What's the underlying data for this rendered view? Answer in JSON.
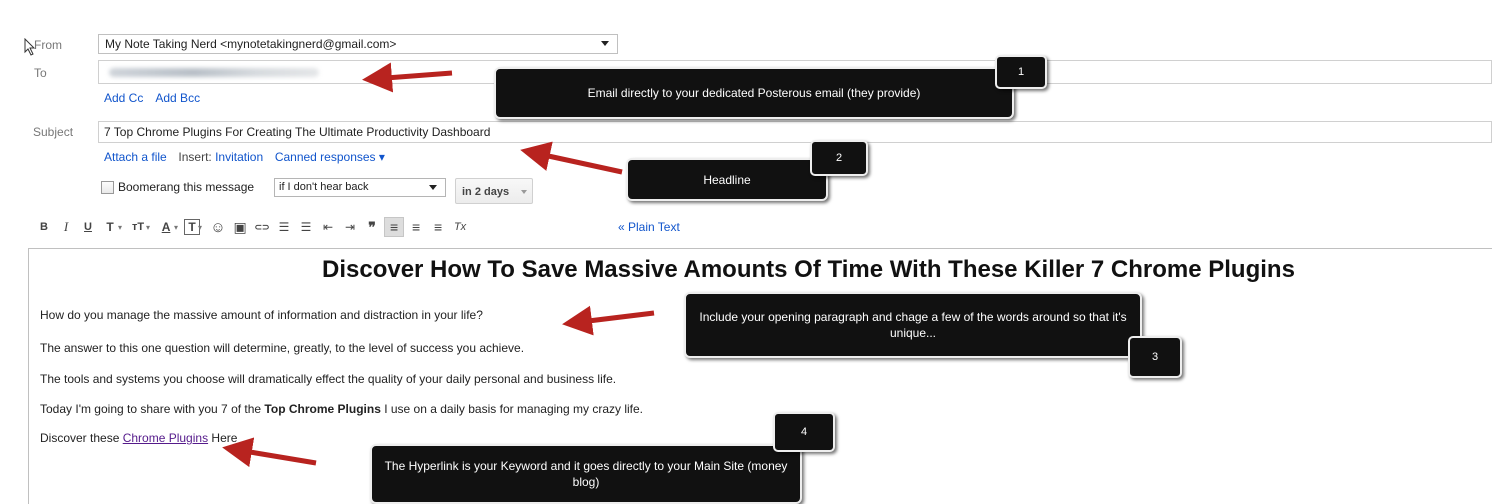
{
  "compose": {
    "from_label": "From",
    "from_value": "My Note Taking Nerd <mynotetakingnerd@gmail.com>",
    "to_label": "To",
    "add_cc": "Add Cc",
    "add_bcc": "Add Bcc",
    "subject_label": "Subject",
    "subject_value": "7 Top Chrome Plugins For Creating The Ultimate Productivity Dashboard",
    "attach_file": "Attach a file",
    "insert_label": "Insert:",
    "invitation": "Invitation",
    "canned_responses": "Canned responses ▾"
  },
  "boomerang": {
    "label": "Boomerang this message",
    "condition": "if I don't hear back",
    "days": "in 2 days"
  },
  "toolbar": {
    "buttons": [
      {
        "icon": "bold-icon",
        "glyph": "B"
      },
      {
        "icon": "italic-icon",
        "glyph": "I"
      },
      {
        "icon": "underline-icon",
        "glyph": "U"
      },
      {
        "icon": "font-icon",
        "glyph": "T"
      },
      {
        "icon": "font-size-icon",
        "glyph": "тT"
      },
      {
        "icon": "text-color-icon",
        "glyph": "A"
      },
      {
        "icon": "highlight-icon",
        "glyph": "T"
      },
      {
        "icon": "emoticon-icon",
        "glyph": "☺"
      },
      {
        "icon": "image-icon",
        "glyph": "▣"
      },
      {
        "icon": "link-icon",
        "glyph": "⊂⊃"
      },
      {
        "icon": "numbered-list-icon",
        "glyph": "☰"
      },
      {
        "icon": "bulleted-list-icon",
        "glyph": "☰"
      },
      {
        "icon": "indent-less-icon",
        "glyph": "⇤"
      },
      {
        "icon": "indent-more-icon",
        "glyph": "⇥"
      },
      {
        "icon": "quote-icon",
        "glyph": "❞"
      },
      {
        "icon": "align-left-icon",
        "glyph": "≡"
      },
      {
        "icon": "align-center-icon",
        "glyph": "≡"
      },
      {
        "icon": "align-right-icon",
        "glyph": "≡"
      },
      {
        "icon": "remove-formatting-icon",
        "glyph": "Tx"
      }
    ],
    "plain_text": "« Plain Text"
  },
  "body": {
    "headline": "Discover How To Save Massive Amounts Of Time With These Killer 7 Chrome Plugins",
    "p1": "How do you manage the massive amount of information and distraction in your life?",
    "p2": "The answer to this one question will determine, greatly, to the level of success you achieve.",
    "p3": "The tools and systems you choose will dramatically effect the quality of your daily personal and business life.",
    "p4_start": "Today I'm going to share with you 7 of the ",
    "p4_bold": "Top Chrome Plugins",
    "p4_end": " I use on a daily basis for managing my crazy life.",
    "p5_start": "Discover these ",
    "p5_link": "Chrome Plugins",
    "p5_end": " Here"
  },
  "annotations": [
    {
      "number": "1",
      "text": "Email directly to your dedicated Posterous email (they provide)"
    },
    {
      "number": "2",
      "text": "Headline"
    },
    {
      "number": "3",
      "text": "Include your opening paragraph and chage a few of the words around so that it's unique..."
    },
    {
      "number": "4",
      "text": "The Hyperlink is your Keyword and it goes directly to your Main Site (money blog)"
    }
  ],
  "colors": {
    "arrow": "#b8231f",
    "link": "#1155cc",
    "visited_link": "#551a8b",
    "callout_bg": "#111111"
  }
}
